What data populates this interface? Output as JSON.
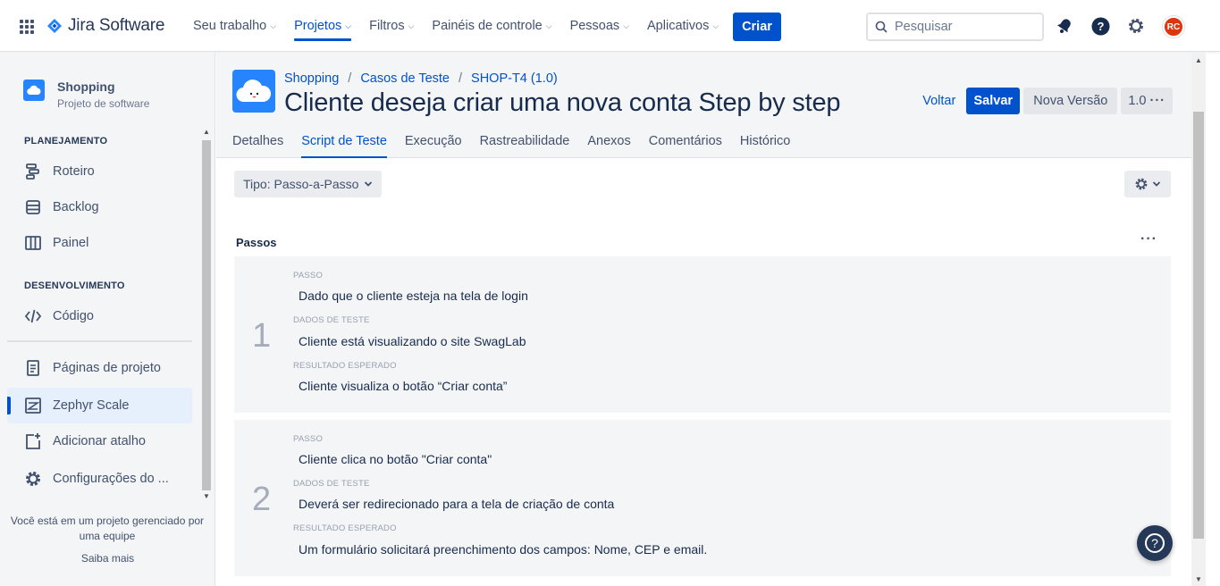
{
  "topnav": {
    "logo_text": "Jira Software",
    "items": [
      {
        "label": "Seu trabalho",
        "active": false
      },
      {
        "label": "Projetos",
        "active": true
      },
      {
        "label": "Filtros",
        "active": false
      },
      {
        "label": "Painéis de controle",
        "active": false
      },
      {
        "label": "Pessoas",
        "active": false
      },
      {
        "label": "Aplicativos",
        "active": false
      }
    ],
    "create_label": "Criar",
    "search_placeholder": "Pesquisar",
    "avatar_initials": "RC"
  },
  "sidebar": {
    "project_name": "Shopping",
    "project_type": "Projeto de software",
    "section_planning": "PLANEJAMENTO",
    "planning_items": [
      "Roteiro",
      "Backlog",
      "Painel"
    ],
    "section_dev": "DESENVOLVIMENTO",
    "dev_items": [
      "Código"
    ],
    "other_items": [
      "Páginas de projeto",
      "Zephyr Scale",
      "Adicionar atalho",
      "Configurações do ..."
    ],
    "footer_text": "Você está em um projeto gerenciado por uma equipe",
    "learn_more": "Saiba mais"
  },
  "header": {
    "breadcrumbs": [
      "Shopping",
      "Casos de Teste",
      "SHOP-T4 (1.0)"
    ],
    "title": "Cliente deseja criar uma nova conta Step by step",
    "back_label": "Voltar",
    "save_label": "Salvar",
    "new_version_label": "Nova Versão",
    "version_label": "1.0"
  },
  "tabs": [
    "Detalhes",
    "Script de Teste",
    "Execução",
    "Rastreabilidade",
    "Anexos",
    "Comentários",
    "Histórico"
  ],
  "active_tab": "Script de Teste",
  "script": {
    "type_label": "Tipo: Passo-a-Passo",
    "steps_title": "Passos",
    "field_labels": {
      "step": "PASSO",
      "test_data": "DADOS DE TESTE",
      "expected": "RESULTADO ESPERADO"
    },
    "steps": [
      {
        "number": "1",
        "step": "Dado que o cliente esteja na tela de login",
        "test_data": "Cliente está visualizando o site SwagLab",
        "expected": "Cliente visualiza o botão “Criar conta”"
      },
      {
        "number": "2",
        "step": "Cliente clica no botão \"Criar conta\"",
        "test_data": "Deverá ser redirecionado para a tela de criação de conta",
        "expected": "Um formulário solicitará preenchimento dos campos: Nome, CEP e email."
      }
    ]
  },
  "colors": {
    "brand": "#0052cc",
    "avatar": "#de350b",
    "project_icon": "#2684ff"
  }
}
